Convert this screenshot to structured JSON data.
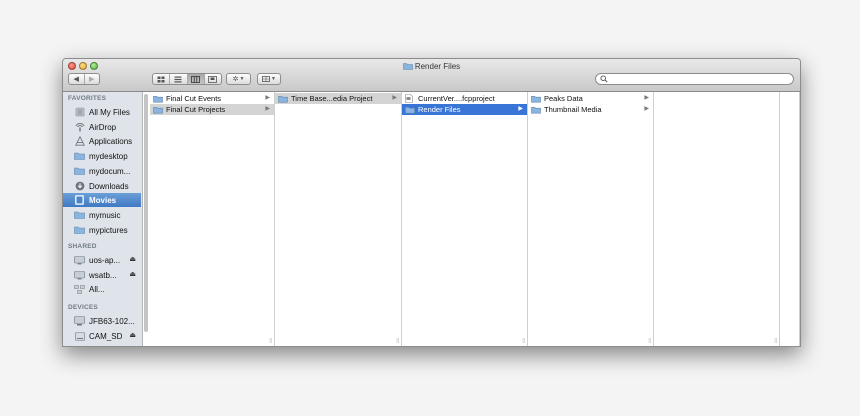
{
  "window": {
    "title": "Render Files"
  },
  "toolbar": {
    "back_icon": "chevron-left-icon",
    "forward_icon": "chevron-right-icon",
    "view_modes": [
      "icon-view",
      "list-view",
      "column-view",
      "coverflow-view"
    ],
    "active_view": "column-view",
    "action_icon": "gear-icon",
    "arrange_icon": "grid-icon",
    "search_placeholder": ""
  },
  "sidebar": {
    "sections": [
      {
        "header": "FAVORITES",
        "items": [
          {
            "label": "All My Files",
            "icon": "all-files-icon"
          },
          {
            "label": "AirDrop",
            "icon": "airdrop-icon"
          },
          {
            "label": "Applications",
            "icon": "applications-icon"
          },
          {
            "label": "mydesktop",
            "icon": "folder-icon"
          },
          {
            "label": "mydocum...",
            "icon": "folder-icon"
          },
          {
            "label": "Downloads",
            "icon": "downloads-icon"
          },
          {
            "label": "Movies",
            "icon": "movies-icon",
            "selected": true
          },
          {
            "label": "mymusic",
            "icon": "folder-icon"
          },
          {
            "label": "mypictures",
            "icon": "folder-icon"
          }
        ]
      },
      {
        "header": "SHARED",
        "items": [
          {
            "label": "uos-ap...",
            "icon": "display-icon",
            "eject": true
          },
          {
            "label": "wsatb...",
            "icon": "display-icon",
            "eject": true
          },
          {
            "label": "All...",
            "icon": "network-icon"
          }
        ]
      },
      {
        "header": "DEVICES",
        "items": [
          {
            "label": "JFB63-102...",
            "icon": "computer-icon"
          },
          {
            "label": "CAM_SD",
            "icon": "drive-icon",
            "eject": true
          }
        ]
      }
    ]
  },
  "columns": [
    {
      "items": [
        {
          "label": "Final Cut Events",
          "icon": "folder-icon",
          "arrow": true
        },
        {
          "label": "Final Cut Projects",
          "icon": "folder-icon",
          "arrow": true,
          "state": "inactive"
        }
      ]
    },
    {
      "items": [
        {
          "label": "Time Base...edia Project",
          "icon": "folder-icon",
          "arrow": true,
          "state": "inactive"
        }
      ]
    },
    {
      "items": [
        {
          "label": "CurrentVer....fcpproject",
          "icon": "document-icon",
          "arrow": false
        },
        {
          "label": "Render Files",
          "icon": "folder-icon",
          "arrow": true,
          "state": "active"
        }
      ]
    },
    {
      "items": [
        {
          "label": "Peaks Data",
          "icon": "folder-icon",
          "arrow": true
        },
        {
          "label": "Thumbnail Media",
          "icon": "folder-icon",
          "arrow": true
        }
      ]
    },
    {
      "items": []
    },
    {
      "items": []
    }
  ],
  "colors": {
    "sidebar_bg": "#dee4ea",
    "selection_active": "#3875d7",
    "selection_inactive": "#d4d4d4",
    "sidebar_selected": "#4a85c8",
    "folder": "#8bb5de"
  }
}
